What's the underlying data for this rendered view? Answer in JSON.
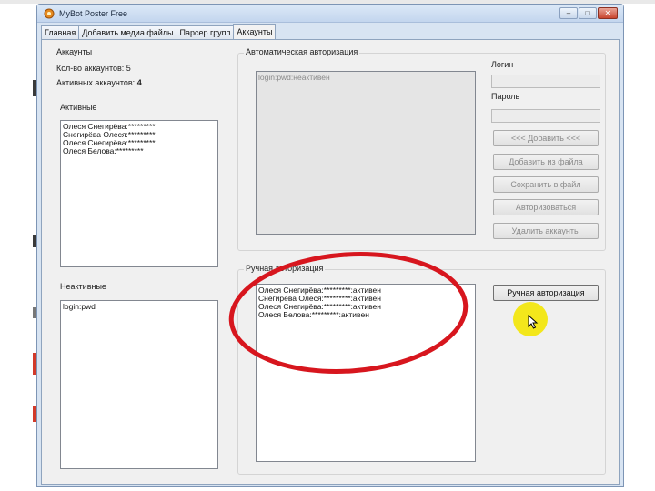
{
  "window": {
    "title": "MyBot Poster Free",
    "controls": {
      "minimize": "–",
      "maximize": "□",
      "close": "✕"
    }
  },
  "tabs": [
    {
      "label": "Главная",
      "active": false
    },
    {
      "label": "Добавить медиа файлы",
      "active": false
    },
    {
      "label": "Парсер групп",
      "active": false
    },
    {
      "label": "Аккаунты",
      "active": true
    }
  ],
  "accounts_panel": {
    "title": "Аккаунты",
    "count_label": "Кол-во аккаунтов:",
    "count_value": "5",
    "active_count_label": "Активных аккаунтов:",
    "active_count_value": "4",
    "active_heading": "Активные",
    "active_items": [
      "Олеся Снегирёва:*********",
      "Снегирёва Олеся:*********",
      "Олеся Снегирёва:*********",
      "Олеся Белова:*********"
    ],
    "inactive_heading": "Неактивные",
    "inactive_items": [
      "login:pwd"
    ]
  },
  "auto_auth": {
    "title": "Автоматическая авторизация",
    "list_items": [
      "login:pwd:неактивен"
    ],
    "login_label": "Логин",
    "password_label": "Пароль",
    "login_value": "",
    "password_value": "",
    "buttons": {
      "add": "<<< Добавить <<<",
      "add_from_file": "Добавить из файла",
      "save_to_file": "Сохранить в файл",
      "authorize": "Авторизоваться",
      "delete_accounts": "Удалить аккаунты"
    }
  },
  "manual_auth": {
    "title": "Ручная авторизация",
    "list_items": [
      "Олеся Снегирёва:*********:активен",
      "Снегирёва Олеся:*********:активен",
      "Олеся Снегирёва:*********:активен",
      "Олеся Белова:*********:активен"
    ],
    "button": "Ручная авторизация"
  },
  "annotation": {
    "ellipse_color": "#d7161e",
    "cursor_highlight_color": "#f2e60f"
  }
}
